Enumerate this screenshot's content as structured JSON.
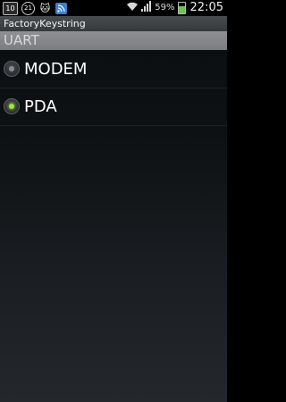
{
  "status_bar": {
    "left_icons": [
      {
        "name": "calendar-icon",
        "text": "10\nFRI"
      },
      {
        "name": "notification-count-icon",
        "text": "21"
      },
      {
        "name": "cat-icon",
        "text": ""
      },
      {
        "name": "rss-icon",
        "text": ""
      }
    ],
    "battery_percent": "59%",
    "battery_level": 0.59,
    "time": "22:05"
  },
  "app": {
    "title": "FactoryKeystring",
    "section_header": "UART"
  },
  "options": [
    {
      "label": "MODEM",
      "selected": false
    },
    {
      "label": "PDA",
      "selected": true
    }
  ],
  "colors": {
    "radio_selected": "#9be83a",
    "battery": "#6cc44a"
  }
}
